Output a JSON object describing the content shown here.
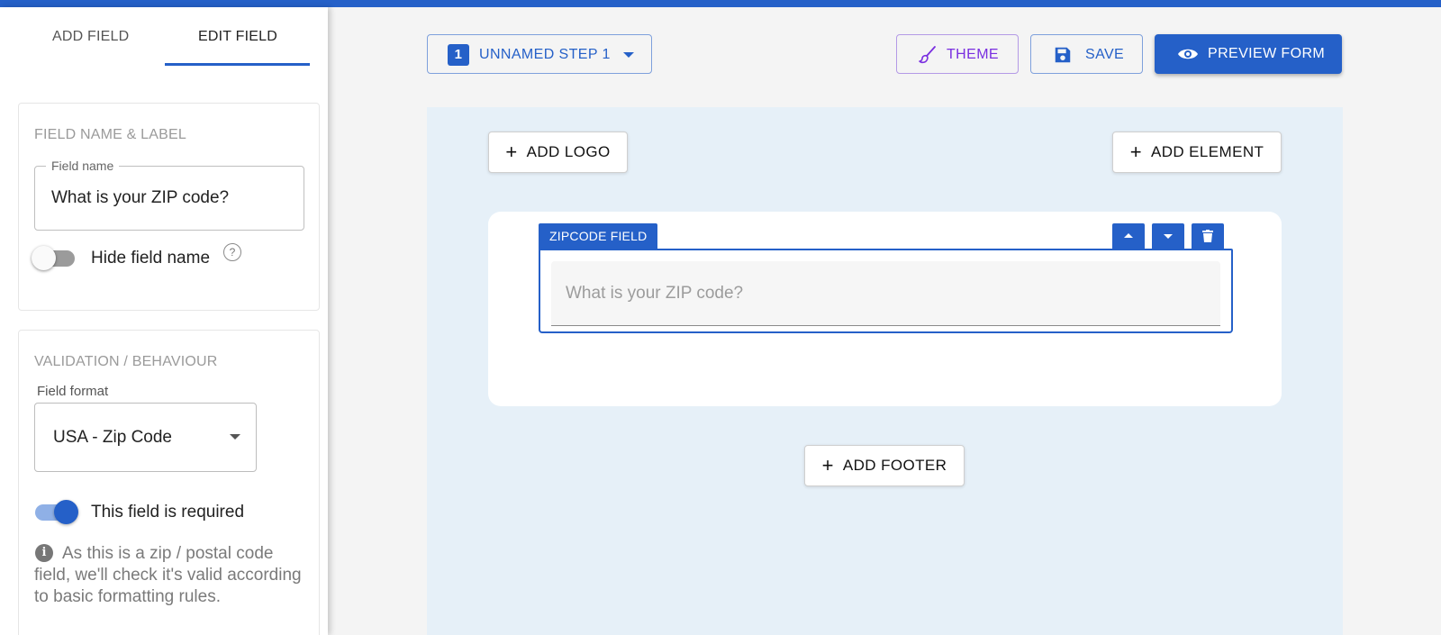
{
  "colors": {
    "accent": "#2560c8",
    "theme_purple": "#7a2fe0",
    "canvas_bg": "#e6f0f8"
  },
  "sidebar": {
    "tabs": [
      {
        "label": "ADD FIELD",
        "active": false
      },
      {
        "label": "EDIT FIELD",
        "active": true
      }
    ],
    "field_name_section": {
      "title": "FIELD NAME & LABEL",
      "field_name_legend": "Field name",
      "field_name_value": "What is your ZIP code?",
      "hide_field_name": {
        "label": "Hide field name",
        "checked": false,
        "help_icon": "?"
      }
    },
    "validation_section": {
      "title": "VALIDATION / BEHAVIOUR",
      "format_label": "Field format",
      "format_value": "USA - Zip Code",
      "required": {
        "label": "This field is required",
        "checked": true
      },
      "info_text": "As this is a zip / postal code field, we'll check it's valid according to basic formatting rules."
    }
  },
  "toolbar": {
    "step": {
      "number": "1",
      "label": "UNNAMED STEP 1"
    },
    "theme_label": "THEME",
    "save_label": "SAVE",
    "preview_label": "PREVIEW FORM"
  },
  "canvas": {
    "add_logo_label": "ADD LOGO",
    "add_element_label": "ADD ELEMENT",
    "add_footer_label": "ADD FOOTER",
    "plus_glyph": "+",
    "field": {
      "tag": "ZIPCODE FIELD",
      "placeholder": "What is your ZIP code?"
    }
  },
  "icons": {
    "theme": "brush-icon",
    "save": "floppy-disk-icon",
    "preview": "eye-icon",
    "step_dropdown": "caret-down-icon",
    "move_up": "caret-up-icon",
    "move_down": "caret-down-icon",
    "delete": "trash-icon",
    "info": "info-icon",
    "help": "question-icon"
  }
}
